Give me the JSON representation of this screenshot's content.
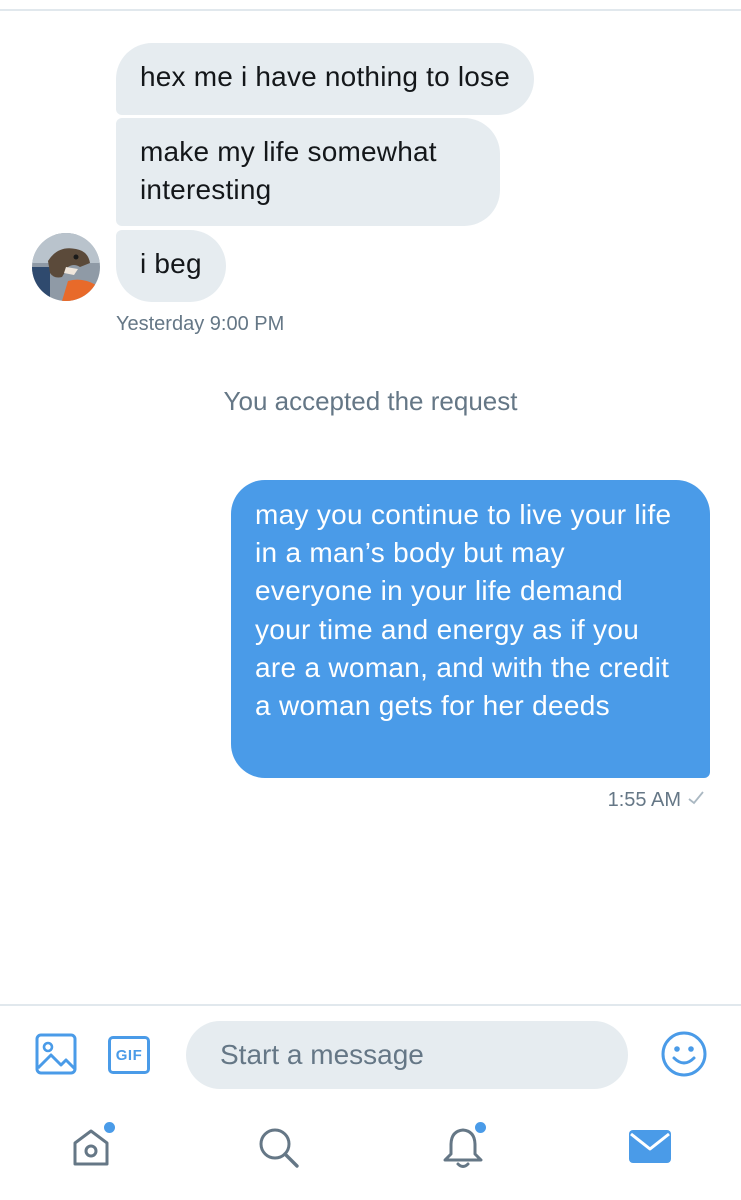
{
  "conversation": {
    "incoming": [
      {
        "text": "hex me i have nothing to lose"
      },
      {
        "text": "make my life somewhat interesting"
      },
      {
        "text": "i beg"
      }
    ],
    "incoming_timestamp": "Yesterday 9:00 PM",
    "system_message": "You accepted the request",
    "outgoing": [
      {
        "text": "may you continue to live your life in a man’s body but may everyone in your life demand your time and energy as if you are a woman, and with the credit a woman gets for her deeds"
      }
    ],
    "outgoing_timestamp": "1:55 AM"
  },
  "composer": {
    "placeholder": "Start a message",
    "gif_label": "GIF",
    "icons": [
      "image-icon",
      "gif-icon",
      "emoji-icon"
    ]
  },
  "tabbar": {
    "tabs": [
      {
        "name": "home",
        "icon": "home-icon",
        "has_dot": true
      },
      {
        "name": "search",
        "icon": "search-icon",
        "has_dot": false
      },
      {
        "name": "notifications",
        "icon": "bell-icon",
        "has_dot": true
      },
      {
        "name": "messages",
        "icon": "envelope-icon",
        "has_dot": false,
        "active": true
      }
    ]
  },
  "colors": {
    "accent": "#4a9be8",
    "incoming_bubble": "#e6ecf0",
    "secondary_text": "#657786",
    "icon_gray": "#657786"
  }
}
